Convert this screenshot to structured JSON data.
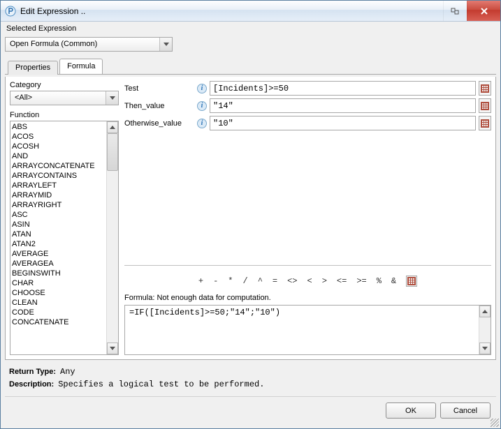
{
  "window": {
    "title": "Edit Expression .."
  },
  "selected_expression": {
    "label": "Selected Expression",
    "value": "Open Formula (Common)"
  },
  "tabs": {
    "properties": "Properties",
    "formula": "Formula"
  },
  "category": {
    "label": "Category",
    "value": "<All>"
  },
  "function_section": {
    "label": "Function",
    "items": [
      "ABS",
      "ACOS",
      "ACOSH",
      "AND",
      "ARRAYCONCATENATE",
      "ARRAYCONTAINS",
      "ARRAYLEFT",
      "ARRAYMID",
      "ARRAYRIGHT",
      "ASC",
      "ASIN",
      "ATAN",
      "ATAN2",
      "AVERAGE",
      "AVERAGEA",
      "BEGINSWITH",
      "CHAR",
      "CHOOSE",
      "CLEAN",
      "CODE",
      "CONCATENATE"
    ]
  },
  "params": {
    "test": {
      "label": "Test",
      "value": "[Incidents]>=50"
    },
    "then": {
      "label": "Then_value",
      "value": "\"14\""
    },
    "otherwise": {
      "label": "Otherwise_value",
      "value": "\"10\""
    }
  },
  "operators": [
    "+",
    "-",
    "*",
    "/",
    "^",
    "=",
    "<>",
    "<",
    ">",
    "<=",
    ">=",
    "%",
    "&"
  ],
  "formula": {
    "status_label": "Formula: Not enough data for computation.",
    "text": "=IF([Incidents]>=50;\"14\";\"10\")"
  },
  "meta": {
    "return_type_label": "Return Type:",
    "return_type_value": "Any",
    "description_label": "Description:",
    "description_value": "Specifies a logical test to be performed."
  },
  "footer": {
    "ok": "OK",
    "cancel": "Cancel"
  }
}
